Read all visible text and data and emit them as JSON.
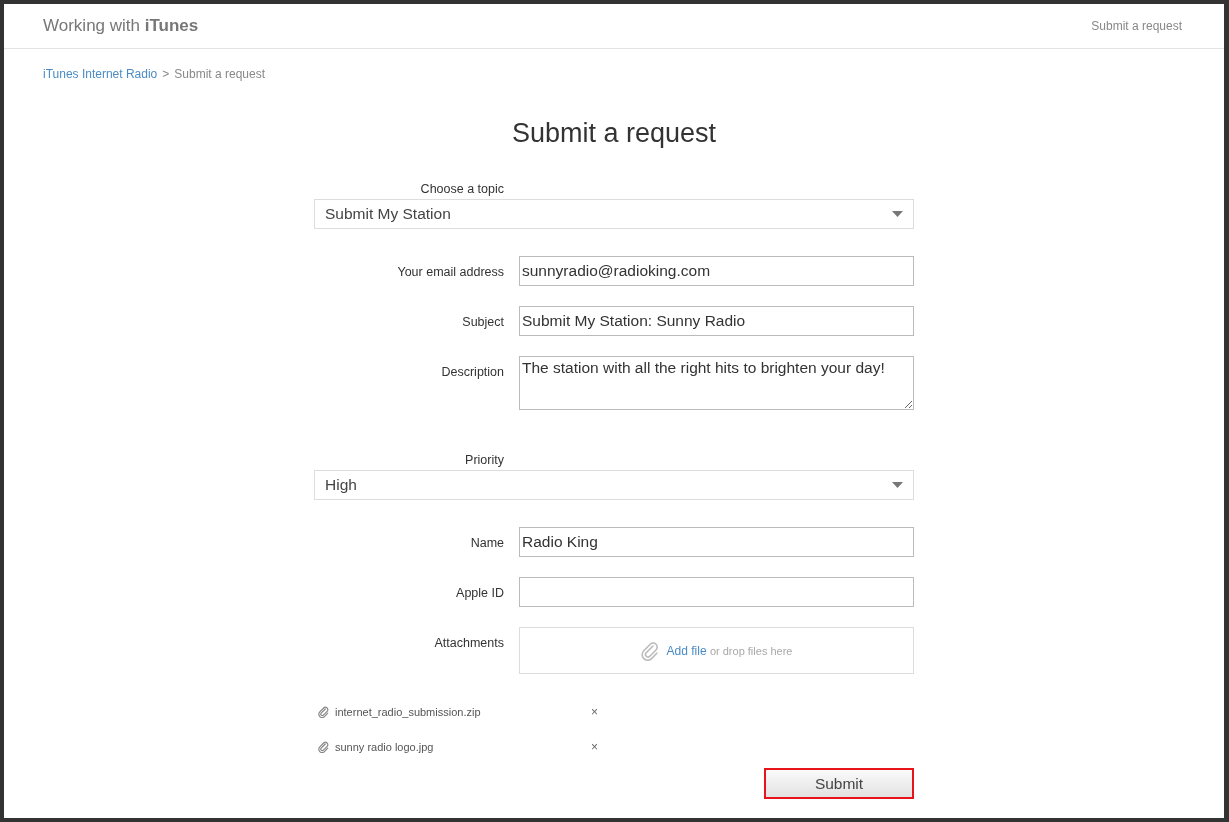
{
  "header": {
    "title": "Working with **iTunes**",
    "nav_link": "Submit a request"
  },
  "breadcrumb": {
    "items": [
      {
        "label": "iTunes Internet Radio",
        "kind": "link"
      },
      {
        "label": "Submit a request",
        "kind": "current"
      }
    ],
    "separator": ">"
  },
  "page_title": "Submit a request",
  "fields": [
    {
      "kind": "select",
      "label": "Choose a topic",
      "value": "Submit My Station"
    },
    {
      "kind": "text",
      "label": "Your email address",
      "value": "sunnyradio@radioking.com"
    },
    {
      "kind": "text",
      "label": "Subject",
      "value": "Submit My Station: Sunny Radio"
    },
    {
      "kind": "textarea",
      "label": "Description",
      "value": "The station with all the right hits to brighten your day!"
    },
    {
      "kind": "select",
      "label": "Priority",
      "value": "High"
    },
    {
      "kind": "text",
      "label": "Name",
      "value": "Radio King"
    },
    {
      "kind": "text",
      "label": "Apple ID"
    },
    {
      "kind": "file",
      "label": "Attachments",
      "link": "Add file",
      "hint": "or drop files here"
    }
  ],
  "attachments": [
    {
      "name": "internet_radio_submission.zip",
      "remove": "×"
    },
    {
      "name": "sunny radio logo.jpg",
      "remove": "×"
    }
  ],
  "submit": {
    "label": "Submit",
    "focused": true
  }
}
